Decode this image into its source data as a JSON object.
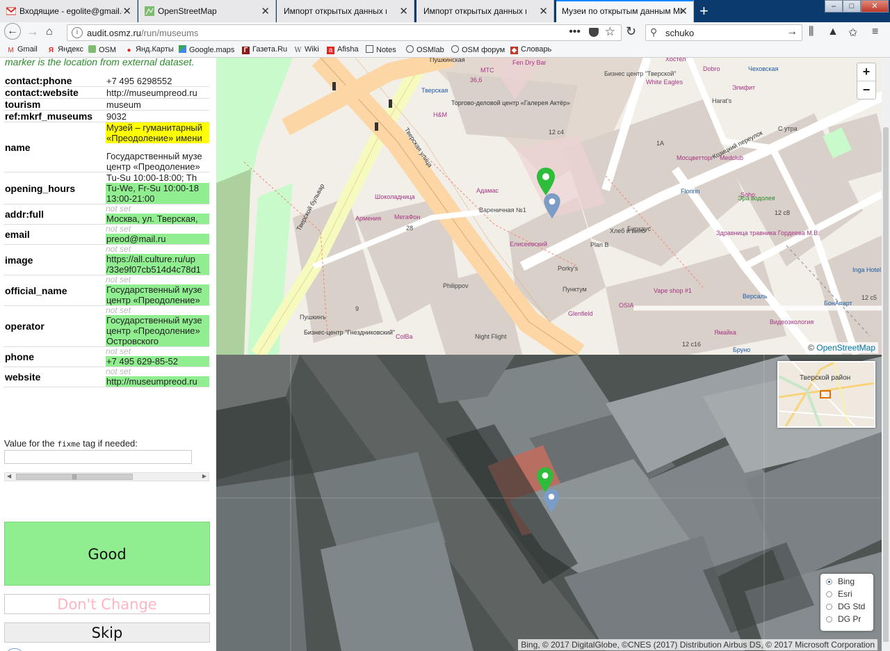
{
  "browser": {
    "tabs": [
      {
        "title": "Входящие - egolite@gmail.com",
        "icon": "gmail-icon"
      },
      {
        "title": "OpenStreetMap",
        "icon": "osm-icon"
      },
      {
        "title": "Импорт открытых данных министе",
        "icon": "none"
      },
      {
        "title": "Импорт открытых данных министе",
        "icon": "none"
      },
      {
        "title": "Музеи по открытым данным Минк",
        "icon": "none",
        "active": true
      }
    ],
    "url_domain": "audit.osmz.ru",
    "url_path": "/run/museums",
    "search_query": "schuko",
    "bookmarks": [
      "Gmail",
      "Яндекс",
      "OSM",
      "Янд.Карты",
      "Google.maps",
      "Газета.Ru",
      "Wiki",
      "Afisha",
      "Notes",
      "OSMlab",
      "OSM форум",
      "Словарь"
    ]
  },
  "panel": {
    "hint": "marker is the location from external dataset.",
    "tags": [
      {
        "key": "contact:phone",
        "values": [
          {
            "text": "+7 495 6298552",
            "style": "plain"
          }
        ]
      },
      {
        "key": "contact:website",
        "values": [
          {
            "text": "http://museumpreod.ru",
            "style": "plain"
          }
        ]
      },
      {
        "key": "tourism",
        "values": [
          {
            "text": "museum",
            "style": "plain"
          }
        ]
      },
      {
        "key": "ref:mkrf_museums",
        "values": [
          {
            "text": "9032",
            "style": "plain"
          }
        ]
      },
      {
        "key": "name",
        "values": [
          {
            "text": "Музей – гуманитарный",
            "style": "yellow"
          },
          {
            "text": "«Преодоление» имени",
            "style": "yellow"
          },
          {
            "text": "",
            "style": "gap"
          },
          {
            "text": "Государственный музе",
            "style": "plain"
          },
          {
            "text": "центр «Преодоление»",
            "style": "plain"
          }
        ]
      },
      {
        "key": "opening_hours",
        "values": [
          {
            "text": "Tu-Su 10:00-18:00; Th",
            "style": "plain"
          },
          {
            "text": "Tu-We, Fr-Su 10:00-18",
            "style": "green"
          },
          {
            "text": "13:00-21:00",
            "style": "green"
          }
        ]
      },
      {
        "key": "addr:full",
        "values": [
          {
            "text": "not set",
            "style": "notset"
          },
          {
            "text": "Москва, ул. Тверская,",
            "style": "green"
          }
        ]
      },
      {
        "key": "email",
        "values": [
          {
            "text": "not set",
            "style": "notset"
          },
          {
            "text": "preod@mail.ru",
            "style": "green"
          }
        ]
      },
      {
        "key": "image",
        "values": [
          {
            "text": "not set",
            "style": "notset"
          },
          {
            "text": "https://all.culture.ru/up",
            "style": "green"
          },
          {
            "text": "/33e9f07cb514d4c78d1",
            "style": "green"
          }
        ]
      },
      {
        "key": "official_name",
        "values": [
          {
            "text": "not set",
            "style": "notset"
          },
          {
            "text": "Государственный музе",
            "style": "green"
          },
          {
            "text": "центр «Преодоление»",
            "style": "green"
          }
        ]
      },
      {
        "key": "operator",
        "values": [
          {
            "text": "not set",
            "style": "notset"
          },
          {
            "text": "Государственный музе",
            "style": "green"
          },
          {
            "text": "центр «Преодоление»",
            "style": "green"
          },
          {
            "text": "Островского",
            "style": "green"
          }
        ]
      },
      {
        "key": "phone",
        "values": [
          {
            "text": "not set",
            "style": "notset"
          },
          {
            "text": "+7 495 629-85-52",
            "style": "green"
          }
        ]
      },
      {
        "key": "website",
        "values": [
          {
            "text": "not set",
            "style": "notset"
          },
          {
            "text": "http://museumpreod.ru",
            "style": "green"
          }
        ]
      }
    ],
    "fixme_label_before": "Value for the ",
    "fixme_code": "fixme",
    "fixme_label_after": " tag if needed:",
    "fixme_value": "",
    "good_label": "Good",
    "dont_change_label": "Don't Change",
    "skip_label": "Skip"
  },
  "map": {
    "zoom_in": "+",
    "zoom_out": "−",
    "attribution_prefix": "© ",
    "attribution_link": "OpenStreetMap",
    "labels": [
      "Пушкинская",
      "Тверская",
      "МТС",
      "Fen Dry Bar",
      "Бизнес центр \"Тверской\"",
      "White Eagles",
      "Dobro",
      "Чеховская",
      "Элифит",
      "Harat's",
      "Торгово-деловой центр «Галерея Актёр»",
      "H&M",
      "Козицкий переулок",
      "С утра",
      "Мосцветторг",
      "Medclub",
      "Florinn",
      "Soho",
      "Эра водолея",
      "Адамас",
      "Вареничная №1",
      "Шоколадница",
      "МегаФон",
      "Армения",
      "Елисеевский",
      "Хлеб и вино",
      "Plan B",
      "Биркаус",
      "Здравница травника Гордеева М.В.",
      "Inga Hotel Moscow",
      "Porky's",
      "Пунктум",
      "Vape shop #1",
      "Версаль",
      "БонАпарт",
      "Philippov",
      "Пушкинъ",
      "Glenfield",
      "OSIA",
      "Видеоэкология",
      "Бизнес-центр \"Гнездниковский\"",
      "ColBa",
      "Night Flight",
      "Ямайка",
      "Бруно",
      "Тверской бульвар",
      "Тверская улица",
      "Хостел",
      "12 с8",
      "12 с5",
      "12 с16",
      "12 с4",
      "28",
      "9",
      "1A",
      "36,6"
    ]
  },
  "satellite": {
    "minimap_label": "Тверской район",
    "layers": [
      {
        "label": "Bing",
        "selected": true
      },
      {
        "label": "Esri",
        "selected": false
      },
      {
        "label": "DG Std",
        "selected": false
      },
      {
        "label": "DG Pr",
        "selected": false
      }
    ],
    "attribution": "Bing, © 2017 DigitalGlobe, ©CNES (2017) Distribution Airbus DS, © 2017 Microsoft Corporation"
  },
  "colors": {
    "green_highlight": "#90ee90",
    "yellow_highlight": "#ffff00",
    "marker_green": "#2ebd3a",
    "marker_blue": "#7a9cc6"
  }
}
